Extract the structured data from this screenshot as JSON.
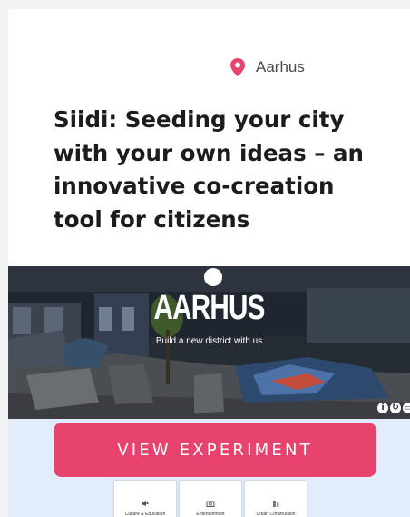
{
  "card": {
    "location": "Aarhus",
    "title": "Siidi: Seeding your city with your own ideas – an innovative co-creation tool for citizens",
    "location_icon": "map-pin-icon"
  },
  "hero": {
    "brand": "AARHUS",
    "subtitle": "Build a new district with us",
    "controls": [
      "info-icon",
      "refresh-icon",
      "window-icon"
    ]
  },
  "cta": {
    "label": "VIEW EXPERIMENT"
  },
  "categories": [
    {
      "label": "Culture & Education",
      "icon": "megaphone-icon"
    },
    {
      "label": "Entertainment",
      "icon": "camera-icon"
    },
    {
      "label": "Urban Construction",
      "icon": "building-icon"
    }
  ],
  "colors": {
    "accent": "#e8436e",
    "pin": "#e8436e",
    "lower_background": "#e2ecfa",
    "page_background": "#f1f2f4"
  }
}
